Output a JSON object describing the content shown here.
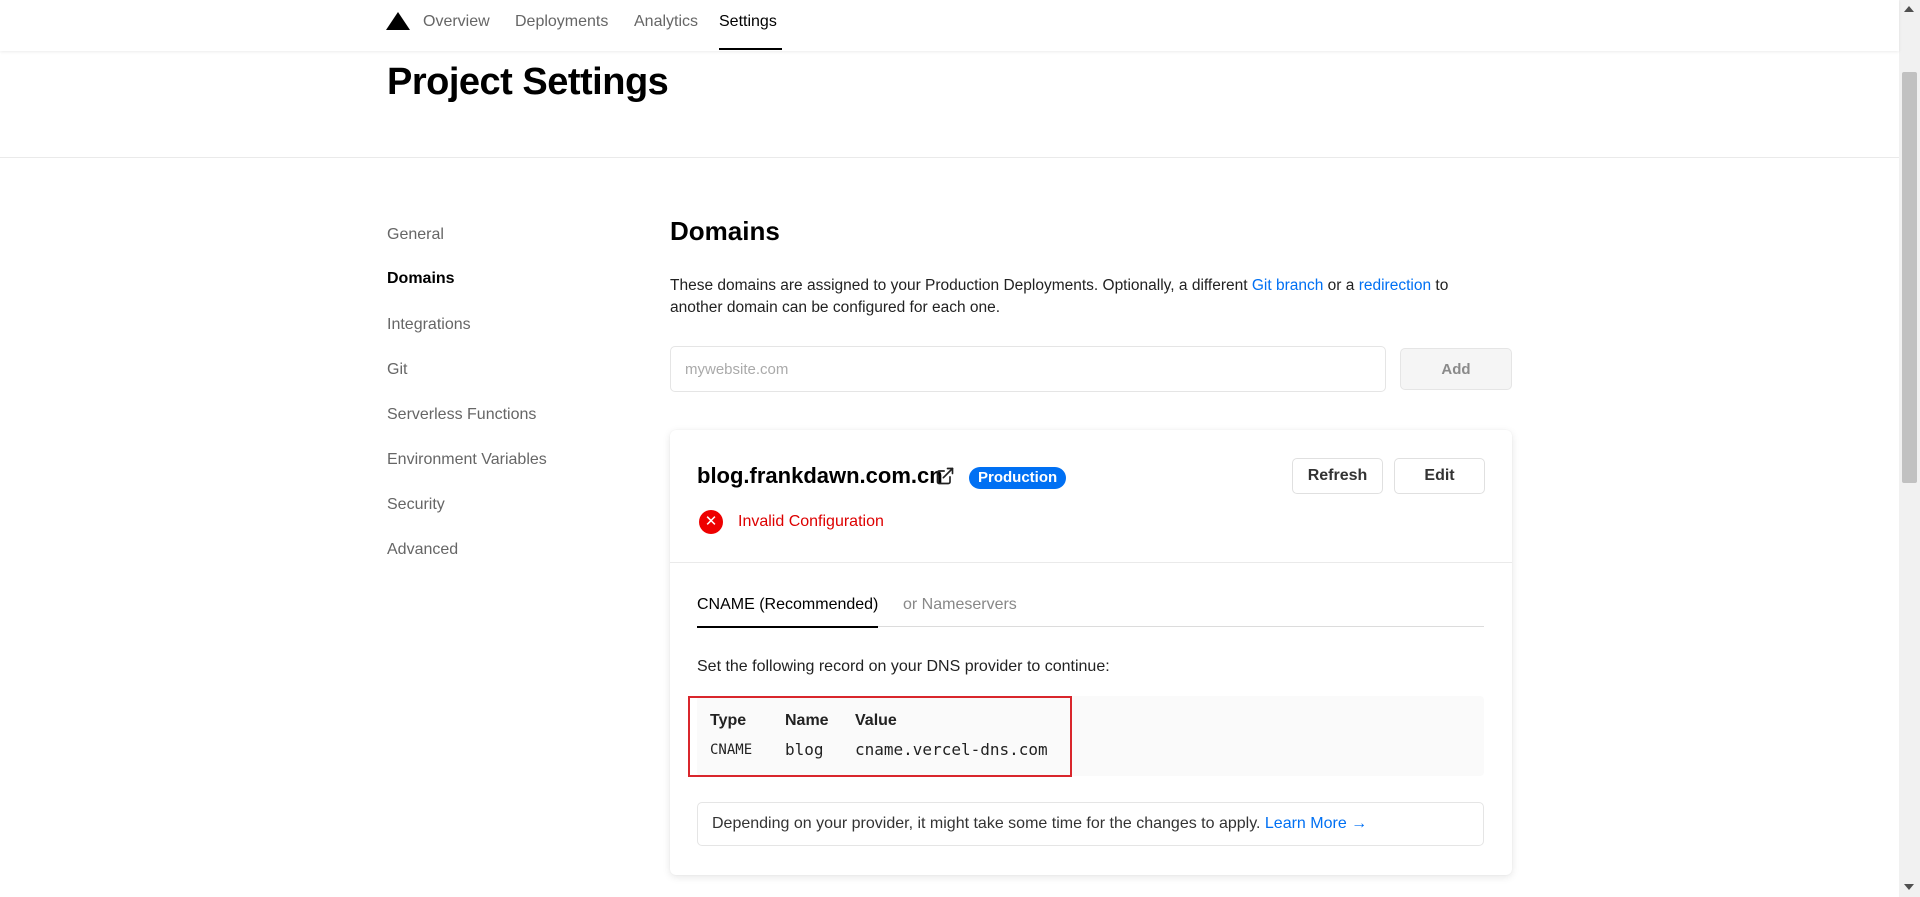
{
  "nav": {
    "tabs": [
      {
        "label": "Overview"
      },
      {
        "label": "Deployments"
      },
      {
        "label": "Analytics"
      },
      {
        "label": "Settings"
      }
    ],
    "active_tab": "Settings"
  },
  "header": {
    "title": "Project Settings"
  },
  "sidebar": {
    "items": [
      {
        "label": "General"
      },
      {
        "label": "Domains"
      },
      {
        "label": "Integrations"
      },
      {
        "label": "Git"
      },
      {
        "label": "Serverless Functions"
      },
      {
        "label": "Environment Variables"
      },
      {
        "label": "Security"
      },
      {
        "label": "Advanced"
      }
    ],
    "active": "Domains"
  },
  "domains": {
    "title": "Domains",
    "description_part1": "These domains are assigned to your Production Deployments. Optionally, a different ",
    "git_branch_link": "Git branch",
    "description_part2": " or a ",
    "redirection_link": "redirection",
    "description_part3": " to another domain can be configured for each one.",
    "input_placeholder": "mywebsite.com",
    "input_value": "",
    "add_label": "Add"
  },
  "domain_card": {
    "name": "blog.frankdawn.com.cn",
    "badge": "Production",
    "refresh_label": "Refresh",
    "edit_label": "Edit",
    "status": "Invalid Configuration",
    "status_icon": "error-x-icon",
    "tabs": [
      {
        "label": "CNAME (Recommended)"
      },
      {
        "label": "or Nameservers"
      }
    ],
    "active_tab": "CNAME (Recommended)",
    "instruction": "Set the following record on your DNS provider to continue:",
    "record": {
      "headers": {
        "type": "Type",
        "name": "Name",
        "value": "Value"
      },
      "type": "CNAME",
      "name": "blog",
      "value": "cname.vercel-dns.com"
    },
    "note": "Depending on your provider, it might take some time for the changes to apply.",
    "learn_more": "Learn More →"
  },
  "colors": {
    "accent": "#0070f3",
    "error": "#ee0000",
    "highlight": "#d9262c"
  }
}
